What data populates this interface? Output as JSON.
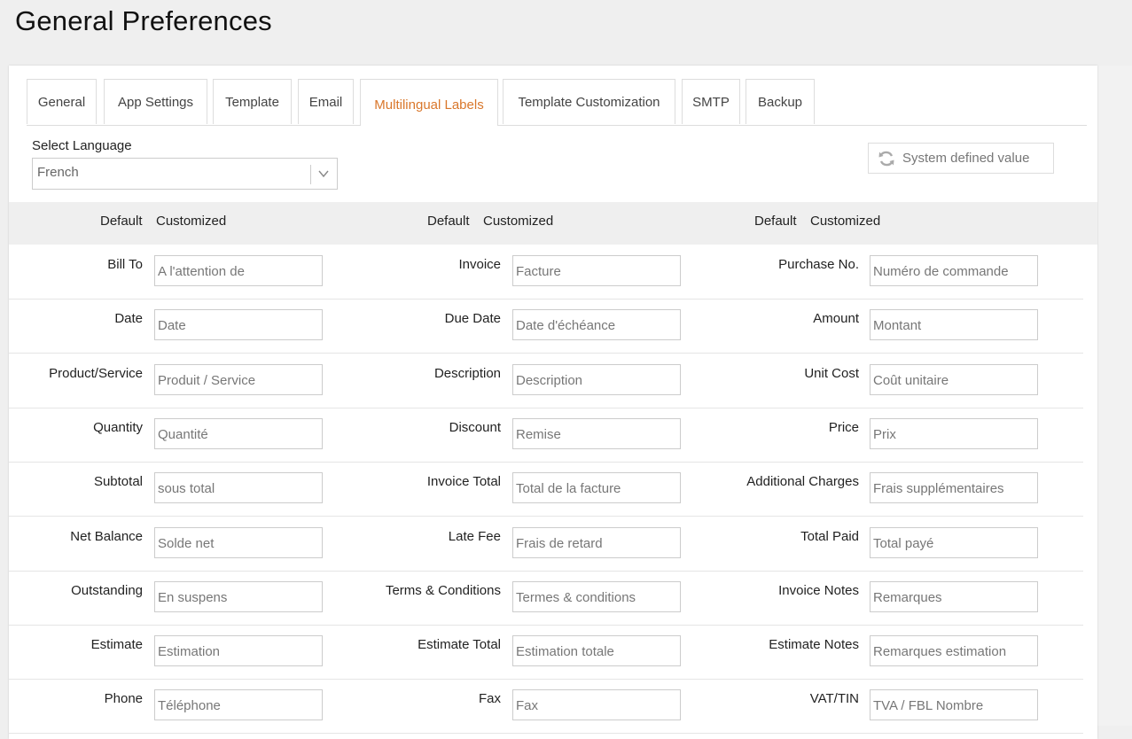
{
  "page": {
    "title": "General Preferences"
  },
  "tabs": [
    {
      "label": "General",
      "active": false
    },
    {
      "label": "App Settings",
      "active": false
    },
    {
      "label": "Template",
      "active": false
    },
    {
      "label": "Email",
      "active": false
    },
    {
      "label": "Multilingual Labels",
      "active": true
    },
    {
      "label": "Template Customization",
      "active": false
    },
    {
      "label": "SMTP",
      "active": false
    },
    {
      "label": "Backup",
      "active": false
    }
  ],
  "language": {
    "label": "Select Language",
    "value": "French"
  },
  "system_button": {
    "label": "System defined value",
    "icon": "refresh-icon"
  },
  "columns": {
    "default": "Default",
    "customized": "Customized"
  },
  "rows": [
    [
      {
        "label": "Bill To",
        "value": "A l'attention de"
      },
      {
        "label": "Invoice",
        "value": "Facture"
      },
      {
        "label": "Purchase No.",
        "value": "Numéro de commande"
      }
    ],
    [
      {
        "label": "Date",
        "value": "Date"
      },
      {
        "label": "Due Date",
        "value": "Date d'échéance"
      },
      {
        "label": "Amount",
        "value": "Montant"
      }
    ],
    [
      {
        "label": "Product/Service",
        "value": "Produit / Service"
      },
      {
        "label": "Description",
        "value": "Description"
      },
      {
        "label": "Unit Cost",
        "value": "Coût unitaire"
      }
    ],
    [
      {
        "label": "Quantity",
        "value": "Quantité"
      },
      {
        "label": "Discount",
        "value": "Remise"
      },
      {
        "label": "Price",
        "value": "Prix"
      }
    ],
    [
      {
        "label": "Subtotal",
        "value": "sous total"
      },
      {
        "label": "Invoice Total",
        "value": "Total de la facture"
      },
      {
        "label": "Additional Charges",
        "value": "Frais supplémentaires"
      }
    ],
    [
      {
        "label": "Net Balance",
        "value": "Solde net"
      },
      {
        "label": "Late Fee",
        "value": "Frais de retard"
      },
      {
        "label": "Total Paid",
        "value": "Total payé"
      }
    ],
    [
      {
        "label": "Outstanding",
        "value": "En suspens"
      },
      {
        "label": "Terms & Conditions",
        "value": "Termes & conditions"
      },
      {
        "label": "Invoice Notes",
        "value": "Remarques"
      }
    ],
    [
      {
        "label": "Estimate",
        "value": "Estimation"
      },
      {
        "label": "Estimate Total",
        "value": "Estimation totale"
      },
      {
        "label": "Estimate Notes",
        "value": "Remarques estimation"
      }
    ],
    [
      {
        "label": "Phone",
        "value": "Téléphone"
      },
      {
        "label": "Fax",
        "value": "Fax"
      },
      {
        "label": "VAT/TIN",
        "value": "TVA / FBL Nombre"
      }
    ]
  ],
  "colors": {
    "accent": "#d9772b",
    "header_band": "#efefef",
    "page_bg": "#efefef"
  }
}
